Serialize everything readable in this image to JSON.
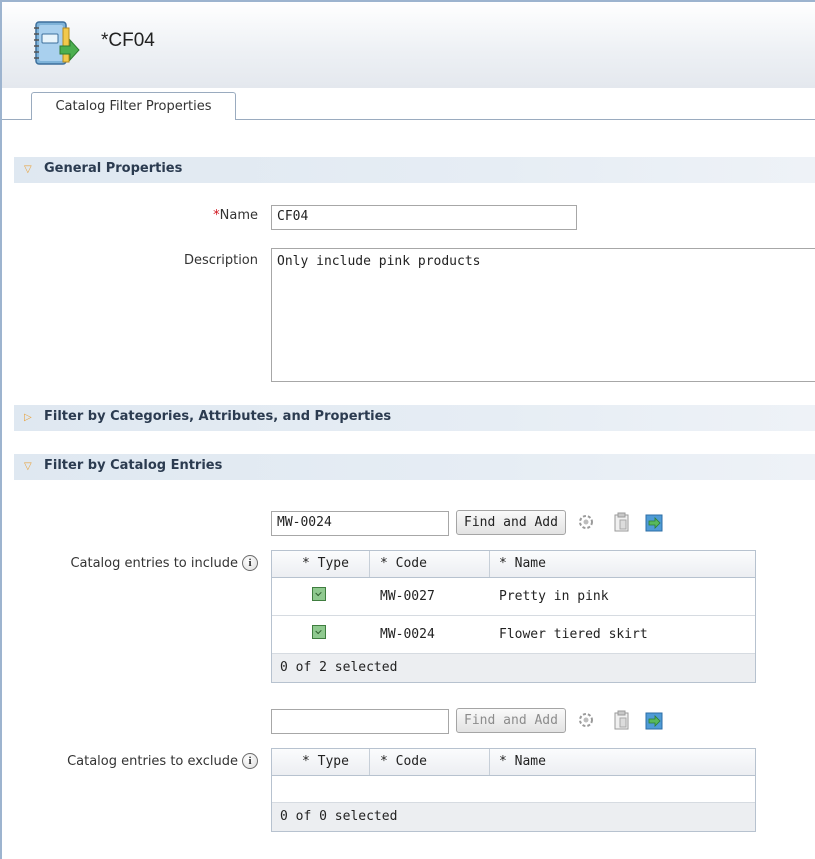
{
  "editor": {
    "title": "*CF04",
    "icon": "catalog-filter-icon"
  },
  "tabs": [
    {
      "label": "Catalog Filter Properties",
      "active": true
    }
  ],
  "sections": {
    "general": {
      "title": "General Properties",
      "expanded": true,
      "name_required_mark": "*",
      "name_label": "Name",
      "name_value": "CF04",
      "description_label": "Description",
      "description_value": "Only include pink products"
    },
    "categories": {
      "title": "Filter by Categories, Attributes, and Properties",
      "expanded": false
    },
    "catalog_entries": {
      "title": "Filter by Catalog Entries",
      "expanded": true
    }
  },
  "include": {
    "label": "Catalog entries to include",
    "search_value": "MW-0024",
    "find_button": "Find and Add",
    "find_enabled": true,
    "columns": [
      "* Type",
      "* Code",
      "* Name"
    ],
    "rows": [
      {
        "type_icon": "catalog-item-icon",
        "code": "MW-0027",
        "name": "Pretty in pink"
      },
      {
        "type_icon": "catalog-item-icon",
        "code": "MW-0024",
        "name": "Flower tiered skirt"
      }
    ],
    "status": "0 of 2 selected"
  },
  "exclude": {
    "label": "Catalog entries to exclude",
    "search_value": "",
    "find_button": "Find and Add",
    "find_enabled": false,
    "columns": [
      "* Type",
      "* Code",
      "* Name"
    ],
    "rows": [],
    "status": "0 of 0 selected"
  },
  "toolbar_icons": [
    "find-catalog-entry-icon",
    "clipboard-icon",
    "open-utilities-icon"
  ],
  "colors": {
    "section_header_bg": "#dfe8f1",
    "twisty": "#e8a23c",
    "required": "#d0121b"
  }
}
